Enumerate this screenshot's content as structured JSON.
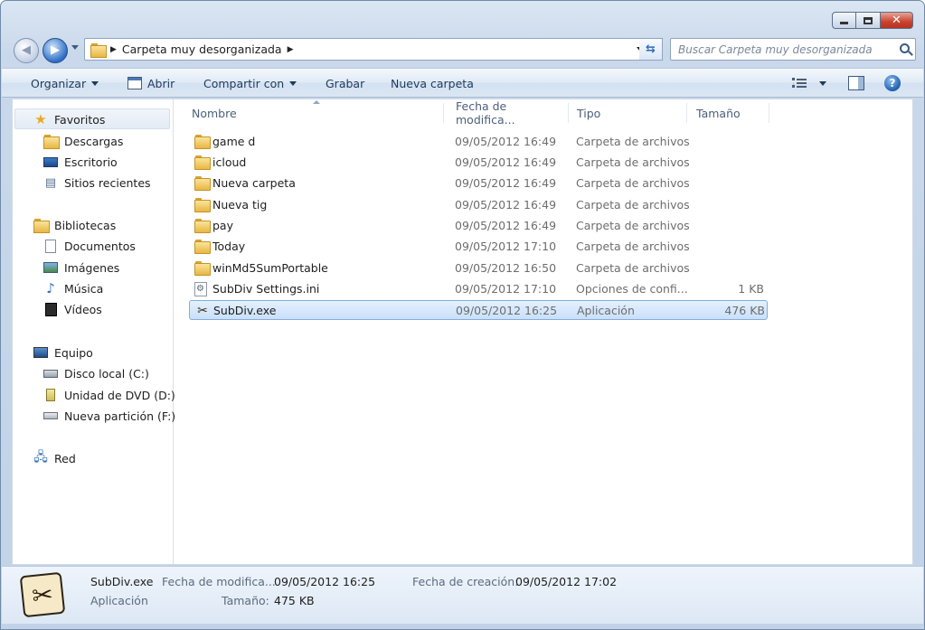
{
  "window": {
    "title": "Carpeta muy desorganizada"
  },
  "address": {
    "path": "Carpeta muy desorganizada"
  },
  "search": {
    "placeholder": "Buscar Carpeta muy desorganizada"
  },
  "toolbar": {
    "organize": "Organizar",
    "open": "Abrir",
    "share": "Compartir con",
    "burn": "Grabar",
    "new_folder": "Nueva carpeta"
  },
  "nav": {
    "favorites": "Favoritos",
    "downloads": "Descargas",
    "desktop": "Escritorio",
    "recent": "Sitios recientes",
    "libraries": "Bibliotecas",
    "documents": "Documentos",
    "images": "Imágenes",
    "music": "Música",
    "videos": "Vídeos",
    "computer": "Equipo",
    "local_disk": "Disco local (C:)",
    "dvd": "Unidad de DVD (D:)",
    "new_partition": "Nueva partición (F:)",
    "network": "Red"
  },
  "columns": {
    "name": "Nombre",
    "date": "Fecha de modifica...",
    "type": "Tipo",
    "size": "Tamaño"
  },
  "files": [
    {
      "name": "game d",
      "date": "09/05/2012 16:49",
      "type": "Carpeta de archivos",
      "size": "",
      "icon": "folder-icon"
    },
    {
      "name": "icloud",
      "date": "09/05/2012 16:49",
      "type": "Carpeta de archivos",
      "size": "",
      "icon": "folder-icon"
    },
    {
      "name": "Nueva carpeta",
      "date": "09/05/2012 16:49",
      "type": "Carpeta de archivos",
      "size": "",
      "icon": "folder-icon"
    },
    {
      "name": "Nueva tig",
      "date": "09/05/2012 16:49",
      "type": "Carpeta de archivos",
      "size": "",
      "icon": "folder-icon"
    },
    {
      "name": "pay",
      "date": "09/05/2012 16:49",
      "type": "Carpeta de archivos",
      "size": "",
      "icon": "folder-icon"
    },
    {
      "name": "Today",
      "date": "09/05/2012 17:10",
      "type": "Carpeta de archivos",
      "size": "",
      "icon": "folder-icon"
    },
    {
      "name": "winMd5SumPortable",
      "date": "09/05/2012 16:50",
      "type": "Carpeta de archivos",
      "size": "",
      "icon": "folder-icon"
    },
    {
      "name": "SubDiv Settings.ini",
      "date": "09/05/2012 17:10",
      "type": "Opciones de confi...",
      "size": "1 KB",
      "icon": "settings-file-icon"
    },
    {
      "name": "SubDiv.exe",
      "date": "09/05/2012 16:25",
      "type": "Aplicación",
      "size": "476 KB",
      "icon": "application-icon"
    }
  ],
  "details": {
    "name": "SubDiv.exe",
    "kind": "Aplicación",
    "modified_label": "Fecha de modifica...",
    "modified_value": "09/05/2012 16:25",
    "size_label": "Tamaño:",
    "size_value": "475 KB",
    "created_label": "Fecha de creación:",
    "created_value": "09/05/2012 17:02"
  },
  "colors": {
    "selection": "#c9e0fa",
    "accent": "#2e6ec5",
    "close": "#c8432e"
  }
}
